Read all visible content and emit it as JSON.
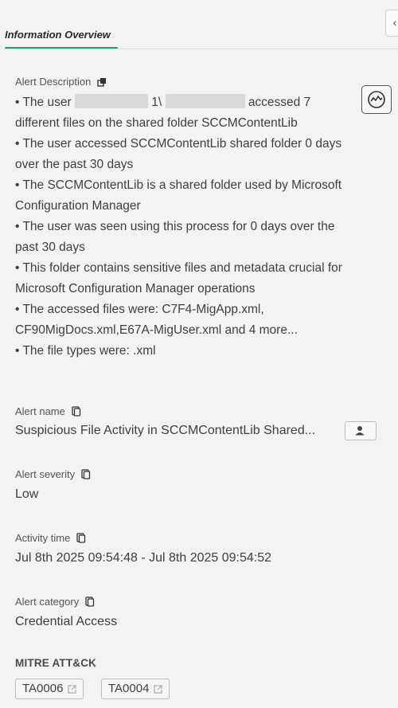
{
  "tabs": {
    "active_label": "Information Overview"
  },
  "description": {
    "label": "Alert Description",
    "line1a": "• The user",
    "line1b": "1\\",
    "line1c": "accessed 7 different files on the shared folder SCCMContentLib",
    "bullets": [
      "• The user accessed SCCMContentLib shared folder 0 days over the past 30 days",
      "• The SCCMContentLib is a shared folder used by Microsoft Configuration Manager",
      "• The user was seen using this process for 0 days over the past 30 days",
      "• This folder contains sensitive files and metadata crucial for Microsoft Configuration Manager operations",
      "• The accessed files were: C7F4-MigApp.xml, CF90MigDocs.xml,E67A-MigUser.xml and 4 more...",
      "• The file types were: .xml"
    ]
  },
  "alert_name": {
    "label": "Alert name",
    "value": "Suspicious File Activity in SCCMContentLib Shared..."
  },
  "alert_severity": {
    "label": "Alert severity",
    "value": "Low"
  },
  "activity_time": {
    "label": "Activity time",
    "value": "Jul 8th 2025 09:54:48 - Jul 8th 2025 09:54:52"
  },
  "alert_category": {
    "label": "Alert category",
    "value": "Credential Access"
  },
  "mitre": {
    "title": "MITRE ATT&CK",
    "tags": [
      "TA0006",
      "TA0004"
    ]
  },
  "icons": {
    "collapse": "chevron-left-icon",
    "popout": "popout-icon",
    "copy": "copy-icon",
    "chart": "activity-chart-icon",
    "user": "user-icon",
    "external": "external-link-icon"
  },
  "colors": {
    "accent": "#22a06b",
    "background": "#f3f3f3"
  }
}
